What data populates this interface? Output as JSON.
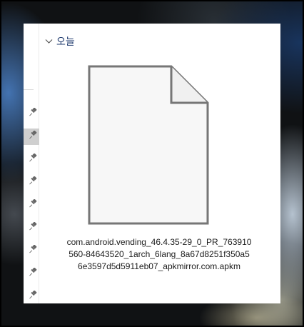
{
  "window": {
    "group": {
      "title": "오늘",
      "expanded": true
    },
    "nav_pane": {
      "pinned_items": [
        {
          "icon": "pin-icon"
        },
        {
          "icon": "pin-icon",
          "selected": true
        },
        {
          "icon": "pin-icon"
        },
        {
          "icon": "pin-icon"
        },
        {
          "icon": "pin-icon"
        },
        {
          "icon": "pin-icon"
        },
        {
          "icon": "pin-icon"
        },
        {
          "icon": "pin-icon"
        },
        {
          "icon": "pin-icon"
        }
      ]
    },
    "files": [
      {
        "name": "com.android.vending_46.4.35-29_0_PR_763910\n560-84643520_1arch_6lang_8a67d8251f350a5\n6e3597d5d5911eb07_apkmirror.com.apkm",
        "icon": "generic-file-icon"
      }
    ]
  },
  "colors": {
    "group_title": "#1e3a6e",
    "pin": "#666666",
    "file_outline": "#767676",
    "file_fill": "#f7f7f7"
  }
}
